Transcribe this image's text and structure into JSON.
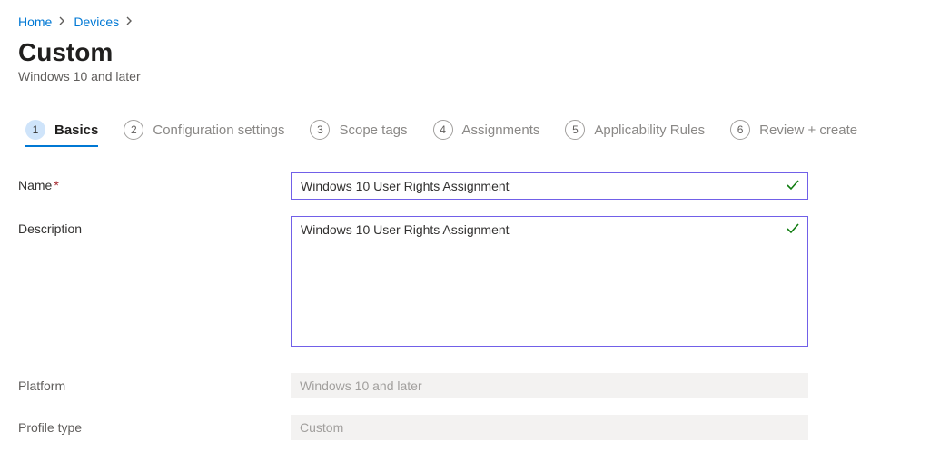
{
  "breadcrumb": {
    "home": "Home",
    "devices": "Devices"
  },
  "header": {
    "title": "Custom",
    "subtitle": "Windows 10 and later"
  },
  "tabs": [
    {
      "num": "1",
      "label": "Basics",
      "active": true
    },
    {
      "num": "2",
      "label": "Configuration settings",
      "active": false
    },
    {
      "num": "3",
      "label": "Scope tags",
      "active": false
    },
    {
      "num": "4",
      "label": "Assignments",
      "active": false
    },
    {
      "num": "5",
      "label": "Applicability Rules",
      "active": false
    },
    {
      "num": "6",
      "label": "Review + create",
      "active": false
    }
  ],
  "form": {
    "name_label": "Name",
    "name_value": "Windows 10 User Rights Assignment",
    "description_label": "Description",
    "description_value": "Windows 10 User Rights Assignment",
    "platform_label": "Platform",
    "platform_value": "Windows 10 and later",
    "profile_type_label": "Profile type",
    "profile_type_value": "Custom"
  }
}
